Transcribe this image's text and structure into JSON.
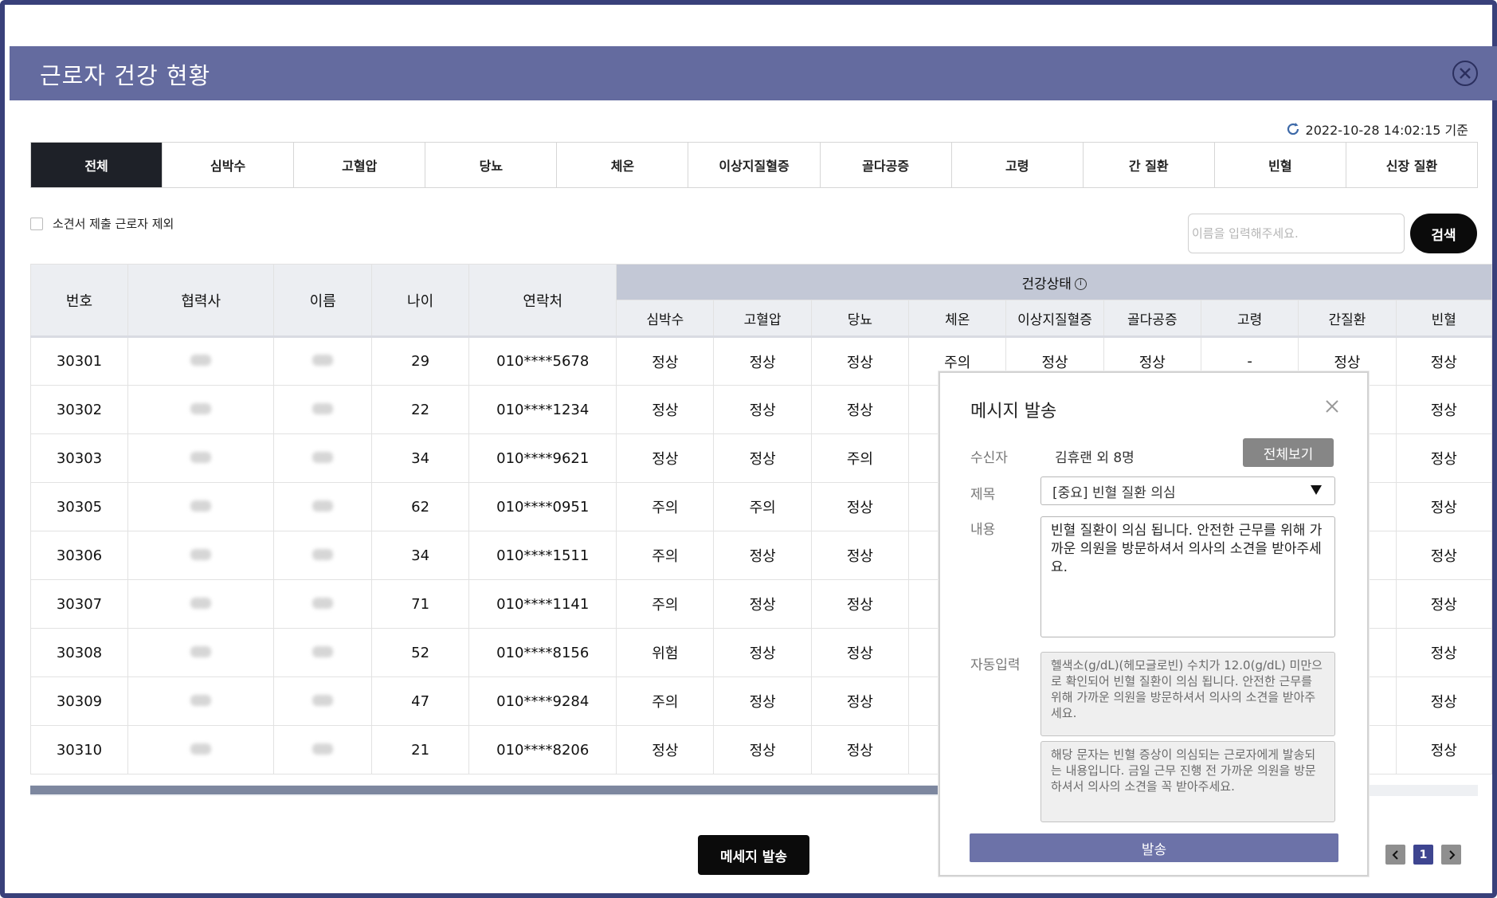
{
  "window": {
    "title": "근로자 건강 현황"
  },
  "timestamp": "2022-10-28 14:02:15 기준",
  "tabs": [
    "전체",
    "심박수",
    "고혈압",
    "당뇨",
    "체온",
    "이상지질혈증",
    "골다공증",
    "고령",
    "간 질환",
    "빈혈",
    "신장 질환"
  ],
  "filter": {
    "exclude_label": "소견서 제출 근로자 제외"
  },
  "search": {
    "placeholder": "이름을 입력해주세요.",
    "button": "검색"
  },
  "table": {
    "columns": {
      "no": "번호",
      "partner": "협력사",
      "name": "이름",
      "age": "나이",
      "contact": "연락처"
    },
    "group_label": "건강상태",
    "health_columns": [
      "심박수",
      "고혈압",
      "당뇨",
      "체온",
      "이상지질혈증",
      "골다공증",
      "고령",
      "간질환",
      "빈혈"
    ],
    "rows": [
      {
        "no": "30301",
        "age": "29",
        "contact": "010****5678",
        "heart": "정상",
        "bp": "정상",
        "diabetes": "정상",
        "temp": "주의",
        "lipid": "정상",
        "osteo": "정상",
        "elderly": "-",
        "liver": "정상",
        "anemia": "정상"
      },
      {
        "no": "30302",
        "age": "22",
        "contact": "010****1234",
        "heart": "정상",
        "bp": "정상",
        "diabetes": "정상",
        "anemia": "정상"
      },
      {
        "no": "30303",
        "age": "34",
        "contact": "010****9621",
        "heart": "정상",
        "bp": "정상",
        "diabetes": "주의",
        "anemia": "정상"
      },
      {
        "no": "30305",
        "age": "62",
        "contact": "010****0951",
        "heart": "주의",
        "bp": "주의",
        "diabetes": "정상",
        "anemia": "정상"
      },
      {
        "no": "30306",
        "age": "34",
        "contact": "010****1511",
        "heart": "주의",
        "bp": "정상",
        "diabetes": "정상",
        "anemia": "정상"
      },
      {
        "no": "30307",
        "age": "71",
        "contact": "010****1141",
        "heart": "주의",
        "bp": "정상",
        "diabetes": "정상",
        "anemia": "정상"
      },
      {
        "no": "30308",
        "age": "52",
        "contact": "010****8156",
        "heart": "위험",
        "bp": "정상",
        "diabetes": "정상",
        "anemia": "정상"
      },
      {
        "no": "30309",
        "age": "47",
        "contact": "010****9284",
        "heart": "주의",
        "bp": "정상",
        "diabetes": "정상",
        "anemia": "정상"
      },
      {
        "no": "30310",
        "age": "21",
        "contact": "010****8206",
        "heart": "정상",
        "bp": "정상",
        "diabetes": "정상",
        "anemia": "정상"
      }
    ]
  },
  "actions": {
    "send_message": "메세지 발송"
  },
  "pagination": {
    "current": "1"
  },
  "modal": {
    "title": "메시지 발송",
    "recipient_label": "수신자",
    "recipient_value": "김휴랜 외 8명",
    "view_all": "전체보기",
    "subject_label": "제목",
    "subject_value": "[중요] 빈혈 질환 의심",
    "content_label": "내용",
    "content_text": "빈혈 질환이 의심 됩니다. 안전한 근무를 위해 가까운 의원을 방문하셔서 의사의 소견을 받아주세요.",
    "auto_label": "자동입력",
    "auto_text_1": "헬색소(g/dL)(헤모글로빈) 수치가 12.0(g/dL) 미만으로 확인되어 빈혈 질환이 의심 됩니다. 안전한 근무를 위해 가까운 의원을 방문하셔서 의사의 소견을 받아주세요.",
    "auto_text_2": "해당 문자는 빈혈 증상이 의심되는 근로자에게 발송되는 내용입니다. 금일 근무 진행 전 가까운 의원을 방문하셔서 의사의 소견을 꼭 받아주세요.",
    "send_button": "발송"
  },
  "colors": {
    "titlebar": "#646b9f",
    "warn": "#e5382e",
    "active_tab": "#1e2128",
    "modal_button": "#6c72a8"
  }
}
